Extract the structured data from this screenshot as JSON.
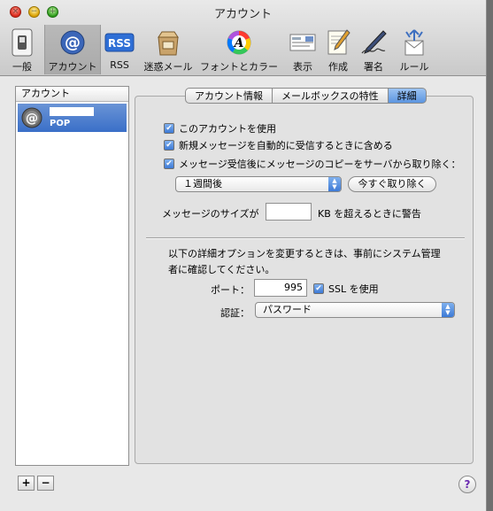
{
  "window": {
    "title": "アカウント"
  },
  "toolbar": {
    "items": [
      {
        "label": "一般",
        "icon": "switch-icon"
      },
      {
        "label": "アカウント",
        "icon": "at-sign-icon",
        "selected": true
      },
      {
        "label": "RSS",
        "icon": "rss-icon",
        "icon_text": "RSS"
      },
      {
        "label": "迷惑メール",
        "icon": "junk-mail-icon"
      },
      {
        "label": "フォントとカラー",
        "icon": "color-wheel-icon",
        "icon_text": "A"
      },
      {
        "label": "表示",
        "icon": "display-icon"
      },
      {
        "label": "作成",
        "icon": "compose-icon"
      },
      {
        "label": "署名",
        "icon": "signature-icon"
      },
      {
        "label": "ルール",
        "icon": "rules-icon"
      }
    ]
  },
  "sidebar": {
    "header": "アカウント",
    "accounts": [
      {
        "type": "POP",
        "icon": "at-sign-icon"
      }
    ]
  },
  "tabs": [
    {
      "label": "アカウント情報",
      "active": false
    },
    {
      "label": "メールボックスの特性",
      "active": false
    },
    {
      "label": "詳細",
      "active": true
    }
  ],
  "advanced": {
    "use_account": {
      "label": "このアカウントを使用",
      "checked": true
    },
    "auto_receive": {
      "label": "新規メッセージを自動的に受信するときに含める",
      "checked": true
    },
    "delete_copy": {
      "label": "メッセージ受信後にメッセージのコピーをサーバから取り除く：",
      "checked": true
    },
    "delete_after": {
      "selected": "１週間後"
    },
    "remove_now_button": "今すぐ取り除く",
    "size_warning": {
      "prefix": "メッセージのサイズが",
      "value": "",
      "suffix": "KB を超えるときに警告"
    },
    "note": "以下の詳細オプションを変更するときは、事前にシステム管理者に確認してください。",
    "note_line1": "以下の詳細オプションを変更するときは、事前にシステム管理",
    "note_line2": "者に確認してください。",
    "port": {
      "label": "ポート：",
      "value": "995"
    },
    "ssl": {
      "label": "SSL を使用",
      "checked": true
    },
    "auth": {
      "label": "認証：",
      "selected": "パスワード"
    }
  },
  "bottom": {
    "add": "+",
    "remove": "−",
    "help": "?"
  },
  "colors": {
    "selection": "#3a6fc8",
    "checkbox": "#3d7ad6",
    "window_bg": "#e8e8e8"
  },
  "check_mark": "✔"
}
